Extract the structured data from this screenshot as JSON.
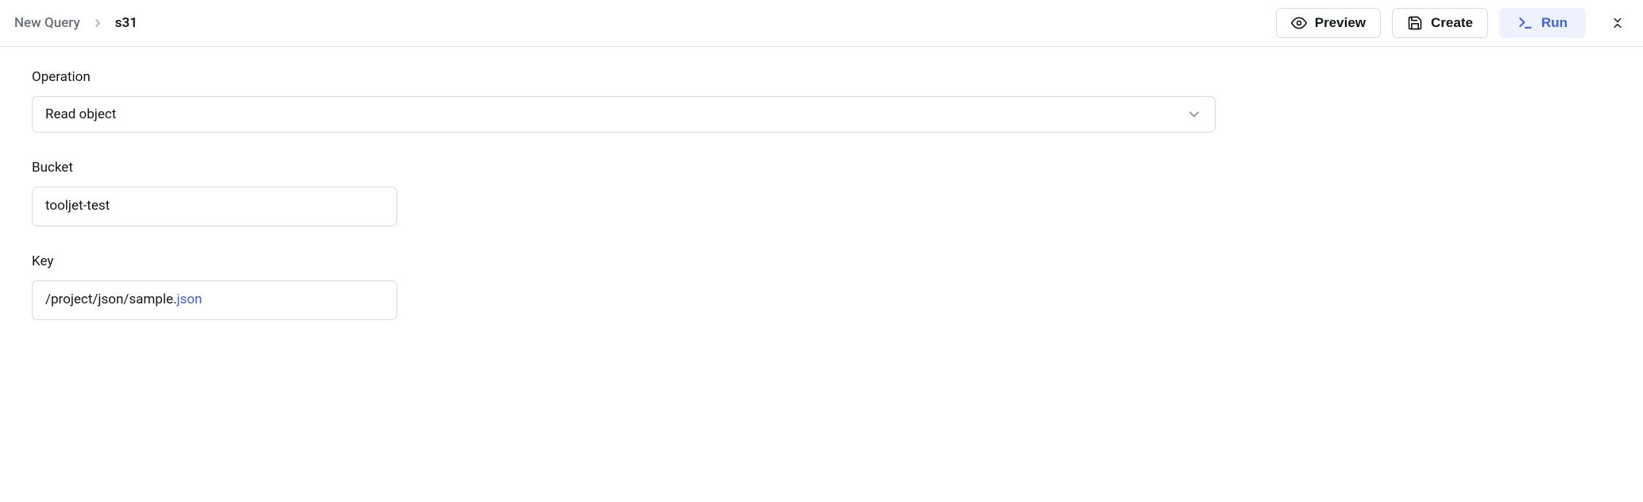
{
  "breadcrumb": {
    "root": "New Query",
    "name": "s31"
  },
  "actions": {
    "preview": "Preview",
    "create": "Create",
    "run": "Run"
  },
  "form": {
    "operation": {
      "label": "Operation",
      "value": "Read object"
    },
    "bucket": {
      "label": "Bucket",
      "value": "tooljet-test"
    },
    "key": {
      "label": "Key",
      "prefix": "/project/json/sample.",
      "suffix": "json"
    }
  }
}
